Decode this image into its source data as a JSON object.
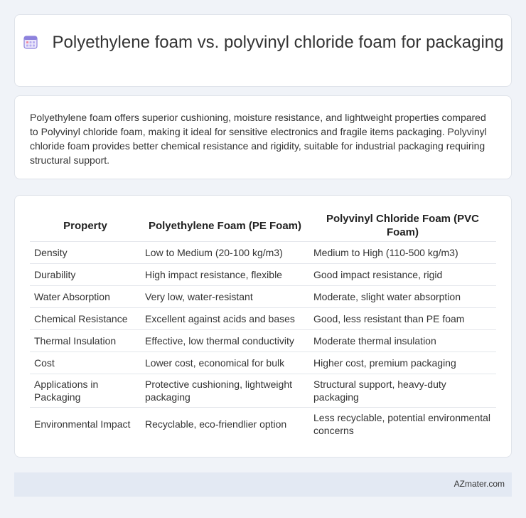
{
  "header": {
    "title": "Polyethylene foam vs. polyvinyl chloride foam for packaging",
    "icon": "calendar-icon",
    "icon_color": "#7b6fd6"
  },
  "summary": {
    "text": "Polyethylene foam offers superior cushioning, moisture resistance, and lightweight properties compared to Polyvinyl chloride foam, making it ideal for sensitive electronics and fragile items packaging. Polyvinyl chloride foam provides better chemical resistance and rigidity, suitable for industrial packaging requiring structural support."
  },
  "table": {
    "headers": [
      "Property",
      "Polyethylene Foam (PE Foam)",
      "Polyvinyl Chloride Foam (PVC Foam)"
    ],
    "rows": [
      [
        "Density",
        "Low to Medium (20-100 kg/m3)",
        "Medium to High (110-500 kg/m3)"
      ],
      [
        "Durability",
        "High impact resistance, flexible",
        "Good impact resistance, rigid"
      ],
      [
        "Water Absorption",
        "Very low, water-resistant",
        "Moderate, slight water absorption"
      ],
      [
        "Chemical Resistance",
        "Excellent against acids and bases",
        "Good, less resistant than PE foam"
      ],
      [
        "Thermal Insulation",
        "Effective, low thermal conductivity",
        "Moderate thermal insulation"
      ],
      [
        "Cost",
        "Lower cost, economical for bulk",
        "Higher cost, premium packaging"
      ],
      [
        "Applications in Packaging",
        "Protective cushioning, lightweight packaging",
        "Structural support, heavy-duty packaging"
      ],
      [
        "Environmental Impact",
        "Recyclable, eco-friendlier option",
        "Less recyclable, potential environmental concerns"
      ]
    ]
  },
  "footer": {
    "text": "AZmater.com"
  }
}
